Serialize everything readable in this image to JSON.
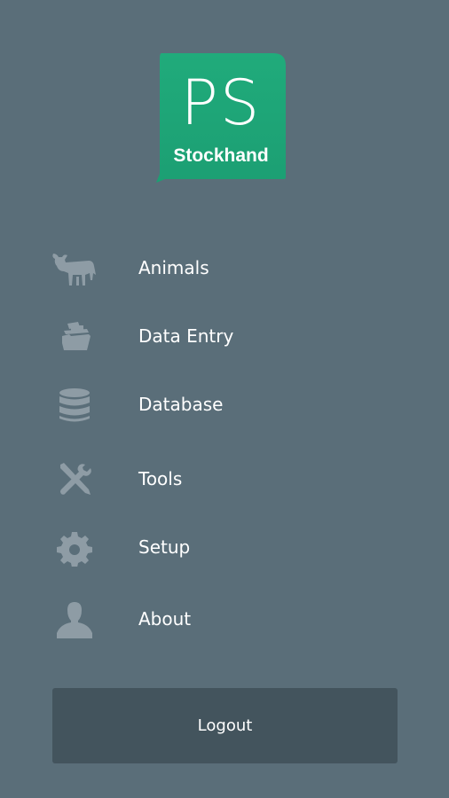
{
  "colors": {
    "background": "#5a6e79",
    "logo_green": "#1fa97a",
    "icon_gray": "#8e9ca5",
    "logout_bg": "#43545d",
    "text": "#ffffff"
  },
  "logo": {
    "initials": "PS",
    "name": "Stockhand"
  },
  "menu": {
    "items": [
      {
        "label": "Animals",
        "icon": "cow-icon"
      },
      {
        "label": "Data Entry",
        "icon": "folder-papers-icon"
      },
      {
        "label": "Database",
        "icon": "database-icon"
      },
      {
        "label": "Tools",
        "icon": "tools-icon"
      },
      {
        "label": "Setup",
        "icon": "gear-icon"
      },
      {
        "label": "About",
        "icon": "person-icon"
      }
    ]
  },
  "logout": {
    "label": "Logout"
  }
}
